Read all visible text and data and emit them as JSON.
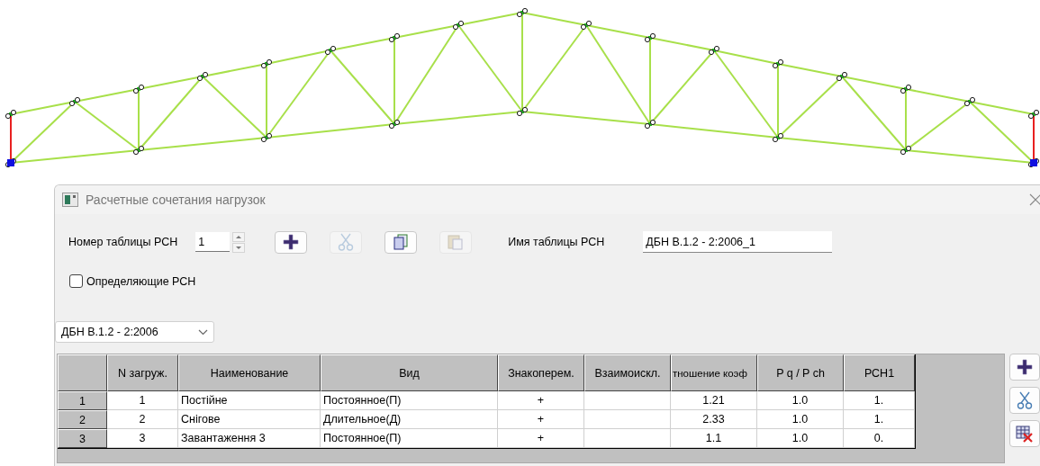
{
  "dialog": {
    "title": "Расчетные сочетания нагрузок"
  },
  "table_number": {
    "label": "Номер таблицы РСН",
    "value": "1"
  },
  "toolbar": [
    {
      "kind": "add",
      "disabled": false
    },
    {
      "kind": "cut",
      "disabled": true
    },
    {
      "kind": "copy",
      "disabled": false
    },
    {
      "kind": "paste",
      "disabled": true
    }
  ],
  "table_name": {
    "label": "Имя таблицы РСН",
    "value": "ДБН В.1.2 - 2:2006_1"
  },
  "defining_checkbox": {
    "label": "Определяющие РСН",
    "checked": false
  },
  "norm_dropdown": {
    "value": "ДБН В.1.2 - 2:2006"
  },
  "table": {
    "columns": [
      "N загруж.",
      "Наименование",
      "Вид",
      "Знакоперем.",
      "Взаимоискл.",
      "тношение коэф",
      "P q / P ch",
      "РСН1"
    ],
    "rows": [
      {
        "header": "1",
        "cells": [
          "1",
          "Постійне",
          "Постоянное(П)",
          "+",
          "",
          "1.21",
          "1.0",
          "1."
        ]
      },
      {
        "header": "2",
        "cells": [
          "2",
          "Снігове",
          "Длительное(Д)",
          "+",
          "",
          "2.33",
          "1.0",
          "1."
        ]
      },
      {
        "header": "3",
        "cells": [
          "3",
          "Завантаження 3",
          "Постоянное(П)",
          "+",
          "",
          "1.1",
          "1.0",
          "0."
        ]
      }
    ]
  },
  "side_buttons": [
    {
      "kind": "add"
    },
    {
      "kind": "cut"
    },
    {
      "kind": "delete"
    }
  ]
}
